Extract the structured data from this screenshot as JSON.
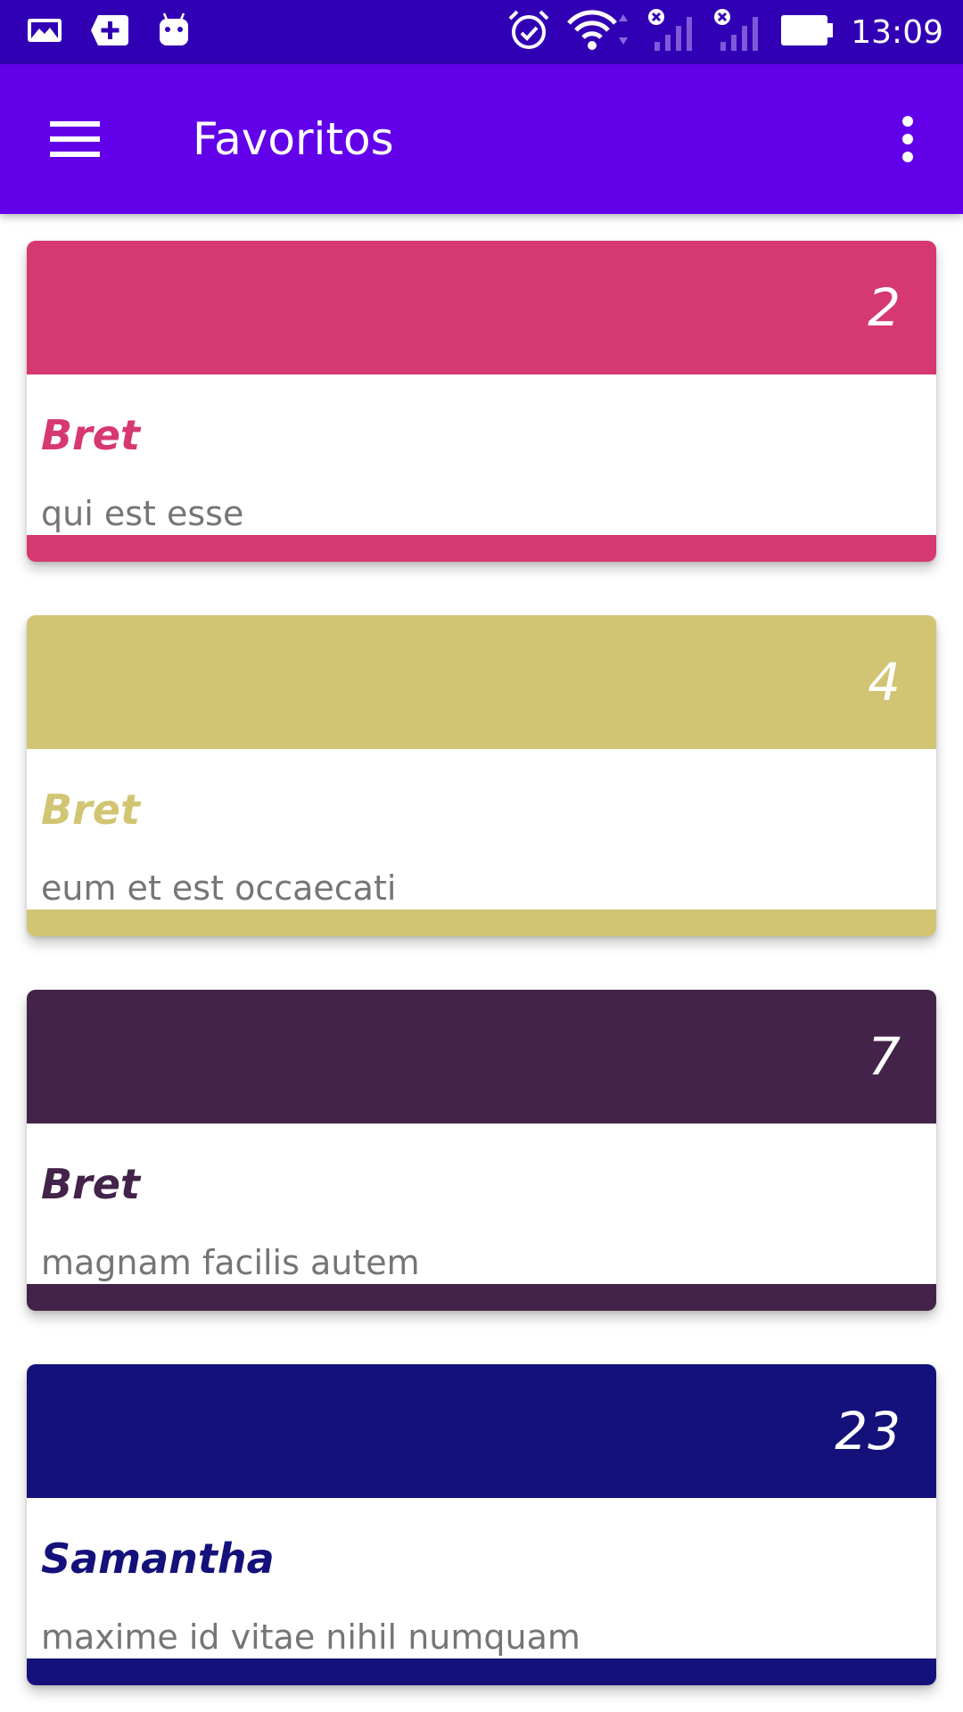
{
  "status_bar": {
    "time": "13:09",
    "icons": [
      "gallery-icon",
      "add-box-icon",
      "android-icon",
      "alarm-icon",
      "wifi-icon",
      "signal-sim1-icon",
      "signal-sim2-icon",
      "battery-icon"
    ],
    "background": "#3200b4"
  },
  "app_bar": {
    "title": "Favoritos",
    "background": "#6200ea",
    "menu_icon": "hamburger-menu-icon",
    "more_icon": "more-vert-icon"
  },
  "favorites": [
    {
      "id": "2",
      "user": "Bret",
      "title": "qui est esse",
      "color": "#d63872"
    },
    {
      "id": "4",
      "user": "Bret",
      "title": "eum et est occaecati",
      "color": "#d1c574"
    },
    {
      "id": "7",
      "user": "Bret",
      "title": "magnam facilis autem",
      "color": "#432349"
    },
    {
      "id": "23",
      "user": "Samantha",
      "title": "maxime id vitae nihil numquam",
      "color": "#14117a"
    }
  ],
  "colors": {
    "card_title_text": "#757575"
  }
}
